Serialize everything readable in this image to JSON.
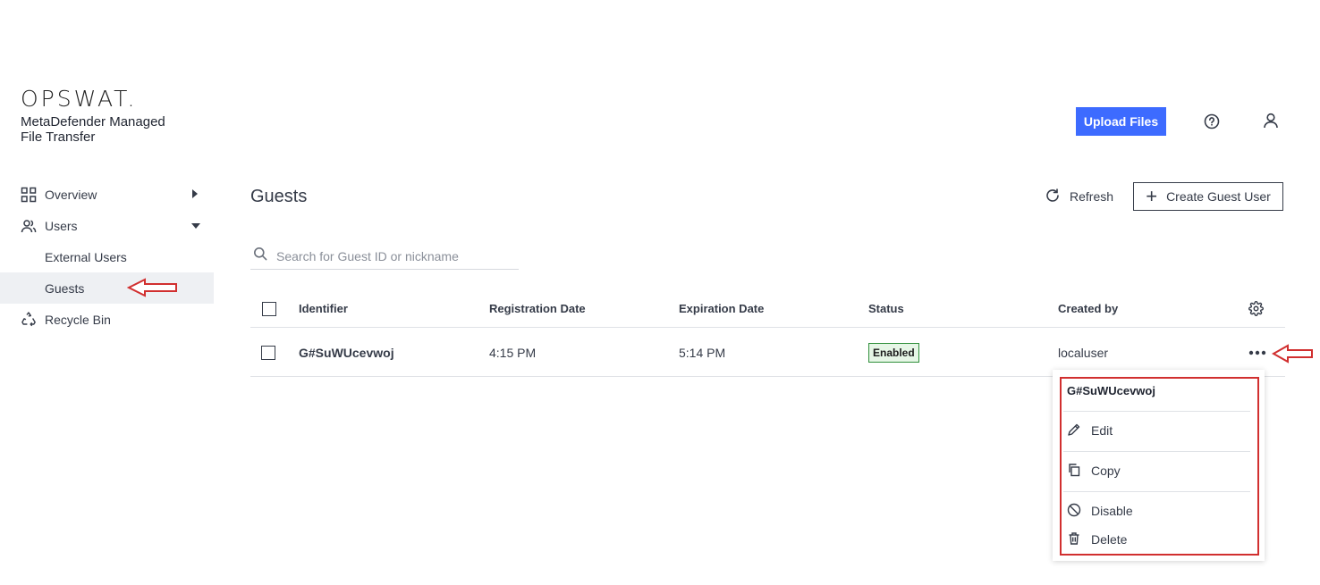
{
  "brand": {
    "logo": "OPSWAT.",
    "product_line1": "MetaDefender Managed",
    "product_line2": "File Transfer"
  },
  "header": {
    "upload_label": "Upload Files",
    "help_icon": "help-circle-icon",
    "user_icon": "user-icon"
  },
  "sidebar": {
    "items": [
      {
        "label": "Overview",
        "icon": "grid-icon",
        "caret": "right"
      },
      {
        "label": "Users",
        "icon": "users-icon",
        "caret": "down"
      },
      {
        "label": "External Users"
      },
      {
        "label": "Guests",
        "active": true
      },
      {
        "label": "Recycle Bin",
        "icon": "recycle-icon"
      }
    ]
  },
  "main": {
    "title": "Guests",
    "refresh_label": "Refresh",
    "create_label": "Create Guest User",
    "search": {
      "placeholder": "Search for Guest ID or nickname",
      "value": ""
    },
    "table": {
      "columns": [
        "Identifier",
        "Registration Date",
        "Expiration Date",
        "Status",
        "Created by"
      ],
      "rows": [
        {
          "identifier": "G#SuWUcevwoj",
          "registration": "4:15 PM",
          "expiration": "5:14 PM",
          "status": "Enabled",
          "created_by": "localuser"
        }
      ]
    }
  },
  "context_menu": {
    "title": "G#SuWUcevwoj",
    "items": [
      {
        "label": "Edit",
        "icon": "pencil-icon"
      },
      {
        "label": "Copy",
        "icon": "copy-icon"
      },
      {
        "label": "Disable",
        "icon": "disable-icon"
      },
      {
        "label": "Delete",
        "icon": "trash-icon"
      }
    ]
  },
  "colors": {
    "accent": "#3d6bff",
    "annotation": "#d12f2f",
    "status_enabled": "#2f8f3a"
  }
}
